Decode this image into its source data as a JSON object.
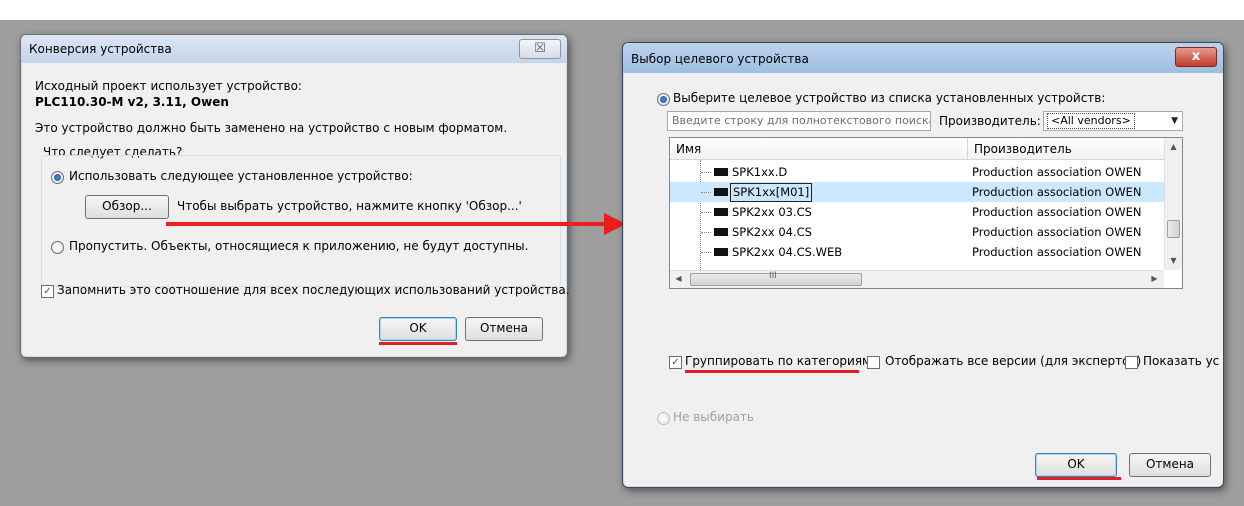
{
  "dialog1": {
    "title": "Конверсия устройства",
    "close_glyph": "☒",
    "intro": "Исходный проект использует устройство:",
    "device": "PLC110.30-M v2, 3.11, Owen",
    "note": "Это устройство должно быть заменено на устройство с новым форматом.",
    "group_label": "Что следует сделать?",
    "radio_use": "Использовать следующее установленное устройство:",
    "browse_button": "Обзор...",
    "browse_hint": "Чтобы выбрать устройство, нажмите кнопку 'Обзор...'",
    "radio_skip": "Пропустить. Объекты, относящиеся к приложению, не будут доступны.",
    "remember_checkbox": "Запомнить это соотношение для всех последующих использований устройства.",
    "ok_button": "OK",
    "cancel_button": "Отмена"
  },
  "dialog2": {
    "title": "Выбор целевого устройства",
    "close_glyph": "x",
    "radio_select": "Выберите целевое устройство из списка установленных устройств:",
    "search_placeholder": "Введите строку для полнотекстового поиска во",
    "vendor_label": "Производитель:",
    "vendor_value": "<All vendors>",
    "columns": {
      "name": "Имя",
      "vendor": "Производитель"
    },
    "rows": [
      {
        "name": "SPK1xx.D",
        "vendor": "Production association OWEN",
        "selected": false
      },
      {
        "name": "SPK1xx[M01]",
        "vendor": "Production association OWEN",
        "selected": true
      },
      {
        "name": "SPK2xx 03.CS",
        "vendor": "Production association OWEN",
        "selected": false
      },
      {
        "name": "SPK2xx 04.CS",
        "vendor": "Production association OWEN",
        "selected": false
      },
      {
        "name": "SPK2xx 04.CS.WEB",
        "vendor": "Production association OWEN",
        "selected": false
      }
    ],
    "hscroll_grip": "III",
    "group_by_category": "Группировать по категориям",
    "show_all_versions": "Отображать все версии (для экспертов)",
    "show_other": "Показать ус",
    "radio_none": "Не выбирать",
    "ok_button": "OK",
    "cancel_button": "Отмена"
  },
  "colors": {
    "annotation_red": "#e02020",
    "selection": "#cce8ff",
    "backdrop": "#9e9e9e"
  }
}
